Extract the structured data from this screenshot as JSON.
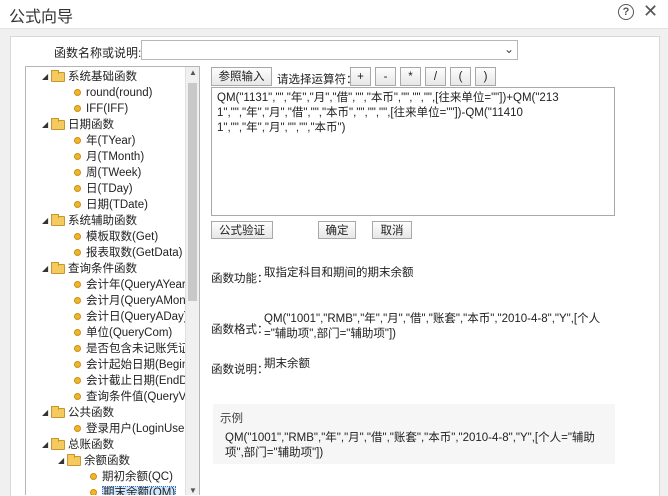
{
  "window": {
    "title": "公式向导",
    "help_glyph": "?",
    "close_glyph": "✕"
  },
  "name_filter": {
    "label": "函数名称或说明:",
    "value": ""
  },
  "tree": {
    "items": [
      {
        "type": "folder",
        "label": "系统基础函数",
        "expanded": true
      },
      {
        "type": "leaf",
        "label": "round(round)"
      },
      {
        "type": "leaf",
        "label": "IFF(IFF)"
      },
      {
        "type": "folder",
        "label": "日期函数",
        "expanded": true
      },
      {
        "type": "leaf",
        "label": "年(TYear)"
      },
      {
        "type": "leaf",
        "label": "月(TMonth)"
      },
      {
        "type": "leaf",
        "label": "周(TWeek)"
      },
      {
        "type": "leaf",
        "label": "日(TDay)"
      },
      {
        "type": "leaf",
        "label": "日期(TDate)"
      },
      {
        "type": "folder",
        "label": "系统辅助函数",
        "expanded": true
      },
      {
        "type": "leaf",
        "label": "模板取数(Get)"
      },
      {
        "type": "leaf",
        "label": "报表取数(GetData)"
      },
      {
        "type": "folder",
        "label": "查询条件函数",
        "expanded": true
      },
      {
        "type": "leaf",
        "label": "会计年(QueryAYear)"
      },
      {
        "type": "leaf",
        "label": "会计月(QueryAMont"
      },
      {
        "type": "leaf",
        "label": "会计日(QueryADay)"
      },
      {
        "type": "leaf",
        "label": "单位(QueryCom)"
      },
      {
        "type": "leaf",
        "label": "是否包含未记账凭证"
      },
      {
        "type": "leaf",
        "label": "会计起始日期(Begin"
      },
      {
        "type": "leaf",
        "label": "会计截止日期(EndDa"
      },
      {
        "type": "leaf",
        "label": "查询条件值(QueryVa"
      },
      {
        "type": "folder",
        "label": "公共函数",
        "expanded": true
      },
      {
        "type": "leaf",
        "label": "登录用户(LoginUser"
      },
      {
        "type": "folder",
        "label": "总账函数",
        "expanded": true
      },
      {
        "type": "subfolder",
        "label": "余额函数",
        "expanded": true
      },
      {
        "type": "subleaf",
        "label": "期初余额(QC)"
      },
      {
        "type": "subleaf",
        "label": "期末余额(QM)",
        "selected": true
      }
    ]
  },
  "toolbar": {
    "reference_button": "参照输入",
    "operator_label": "请选择运算符：",
    "operators": [
      "+",
      "-",
      "*",
      "/",
      "(",
      ")"
    ]
  },
  "formula": {
    "text": "QM(\"1131\",\"\",\"年\",\"月\",\"借\",\"\",\"本币\",\"\",\"\",\"\",[往来单位=\"\"])+QM(\"2131\",\"\",\"年\",\"月\",\"借\",\"\",\"本币\",\"\",\"\",\"\",[往来单位=\"\"])-QM(\"114101\",\"\",\"年\",\"月\",\"\",\"\",\"本币\")"
  },
  "actions": {
    "validate": "公式验证",
    "ok": "确定",
    "cancel": "取消"
  },
  "info": {
    "function_label": "函数功能：",
    "function_text": "取指定科目和期间的期末余额",
    "format_label": "函数格式：",
    "format_text": "QM(\"1001\",\"RMB\",\"年\",\"月\",\"借\",\"账套\",\"本币\",\"2010-4-8\",\"Y\",[个人=\"辅助项\",部门=\"辅助项\"])",
    "desc_label": "函数说明：",
    "desc_text": "期末余额"
  },
  "example": {
    "heading": "示例",
    "text": "QM(\"1001\",\"RMB\",\"年\",\"月\",\"借\",\"账套\",\"本币\",\"2010-4-8\",\"Y\",[个人=\"辅助项\",部门=\"辅助项\"])"
  }
}
